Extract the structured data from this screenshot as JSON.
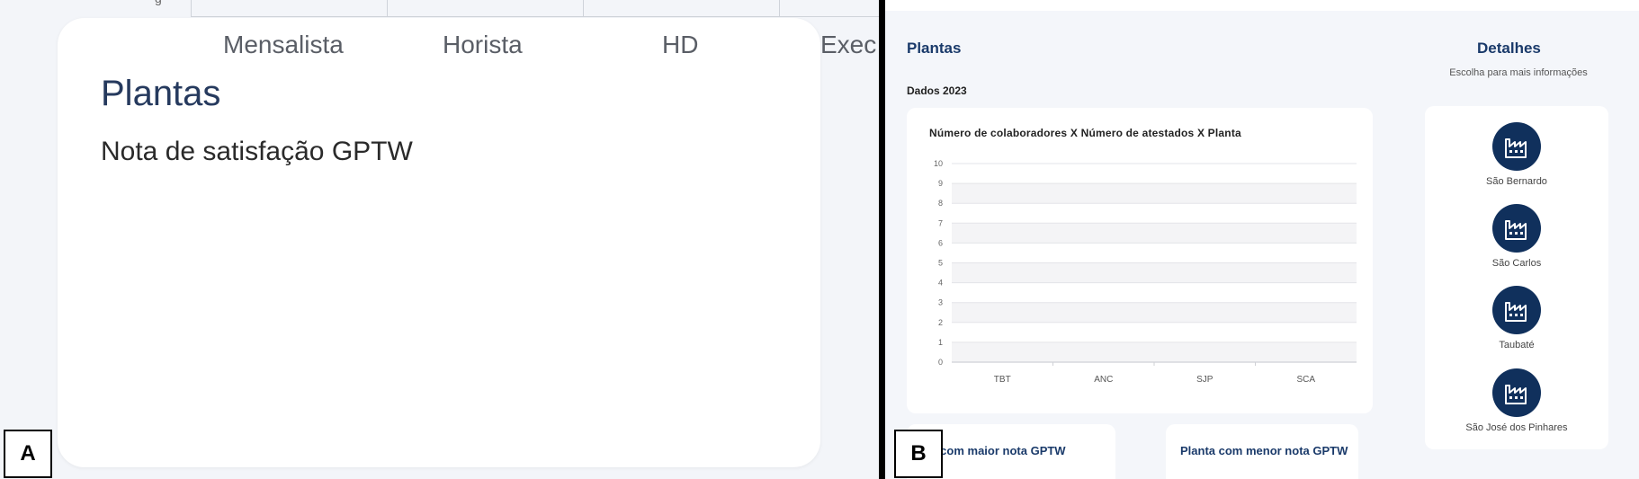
{
  "panel_a": {
    "tabs": [
      "Mensalista",
      "Horista",
      "HD",
      "Exec"
    ],
    "stub_text": "g",
    "title": "Plantas",
    "subtitle": "Nota de satisfação GPTW"
  },
  "panel_b": {
    "section_title": "Plantas",
    "data_label": "Dados 2023",
    "details_title": "Detalhes",
    "details_hint": "Escolha para mais informações",
    "plants": [
      {
        "name": "São Bernardo",
        "icon": "factory-icon"
      },
      {
        "name": "São Carlos",
        "icon": "factory-icon"
      },
      {
        "name": "Taubaté",
        "icon": "factory-icon"
      },
      {
        "name": "São José dos Pinhares",
        "icon": "factory-icon"
      }
    ],
    "best_label": "ta com maior nota GPTW",
    "worst_label": "Planta com menor nota GPTW"
  },
  "chart_data": {
    "type": "bar",
    "title": "Número de colaboradores X Número de atestados X Planta",
    "categories": [
      "TBT",
      "ANC",
      "SJP",
      "SCA"
    ],
    "values": [
      0,
      0,
      0,
      0
    ],
    "ylim": [
      0,
      10
    ],
    "yticks": [
      "0",
      "1",
      "2",
      "3",
      "4",
      "5",
      "6",
      "7",
      "8",
      "9",
      "10"
    ],
    "grid": true,
    "xlabel": "",
    "ylabel": ""
  },
  "labels": {
    "a": "A",
    "b": "B"
  }
}
